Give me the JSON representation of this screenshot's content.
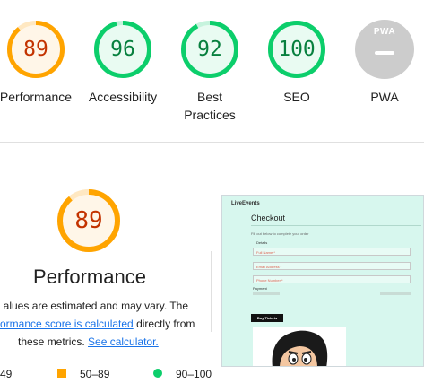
{
  "summary_gauges": [
    {
      "label": "Performance",
      "score": "89",
      "fraction": 0.89,
      "color": "#ffa400",
      "track": "#ffe8c2",
      "fill": "#fff6e8",
      "text": "#c33300"
    },
    {
      "label": "Accessibility",
      "score": "96",
      "fraction": 0.96,
      "color": "#0cce6b",
      "track": "#c6f3dd",
      "fill": "#e9fbf2",
      "text": "#08803f"
    },
    {
      "label_line1": "Best",
      "label_line2": "Practices",
      "score": "92",
      "fraction": 0.92,
      "color": "#0cce6b",
      "track": "#c6f3dd",
      "fill": "#e9fbf2",
      "text": "#08803f"
    },
    {
      "label": "SEO",
      "score": "100",
      "fraction": 1.0,
      "color": "#0cce6b",
      "track": "#c6f3dd",
      "fill": "#e9fbf2",
      "text": "#08803f"
    },
    {
      "label": "PWA",
      "badge": "PWA",
      "color": "#cccccc"
    }
  ],
  "performance": {
    "score": "89",
    "fraction": 0.89,
    "title": "Performance",
    "desc_line1": "alues are estimated and may vary. The",
    "desc_link1": "ormance score is calculated",
    "desc_line2_rest": " directly from",
    "desc_line3_pre": "these metrics. ",
    "desc_link2": "See calculator.",
    "legend": [
      {
        "range": "49",
        "shape": "triangle",
        "color": "#ff4e42"
      },
      {
        "range": "50–89",
        "shape": "square",
        "color": "#ffa400"
      },
      {
        "range": "90–100",
        "shape": "circle",
        "color": "#0cce6b"
      }
    ]
  },
  "page_screenshot": {
    "brand": "LiveEvents",
    "heading": "Checkout",
    "instruction": "Fill out below to complete your order",
    "details_label": "Details",
    "fields": [
      "Full Name *",
      "Email Address *",
      "Phone Number *"
    ],
    "payment_label": "Payment",
    "buy_button": "Buy Tickets"
  }
}
